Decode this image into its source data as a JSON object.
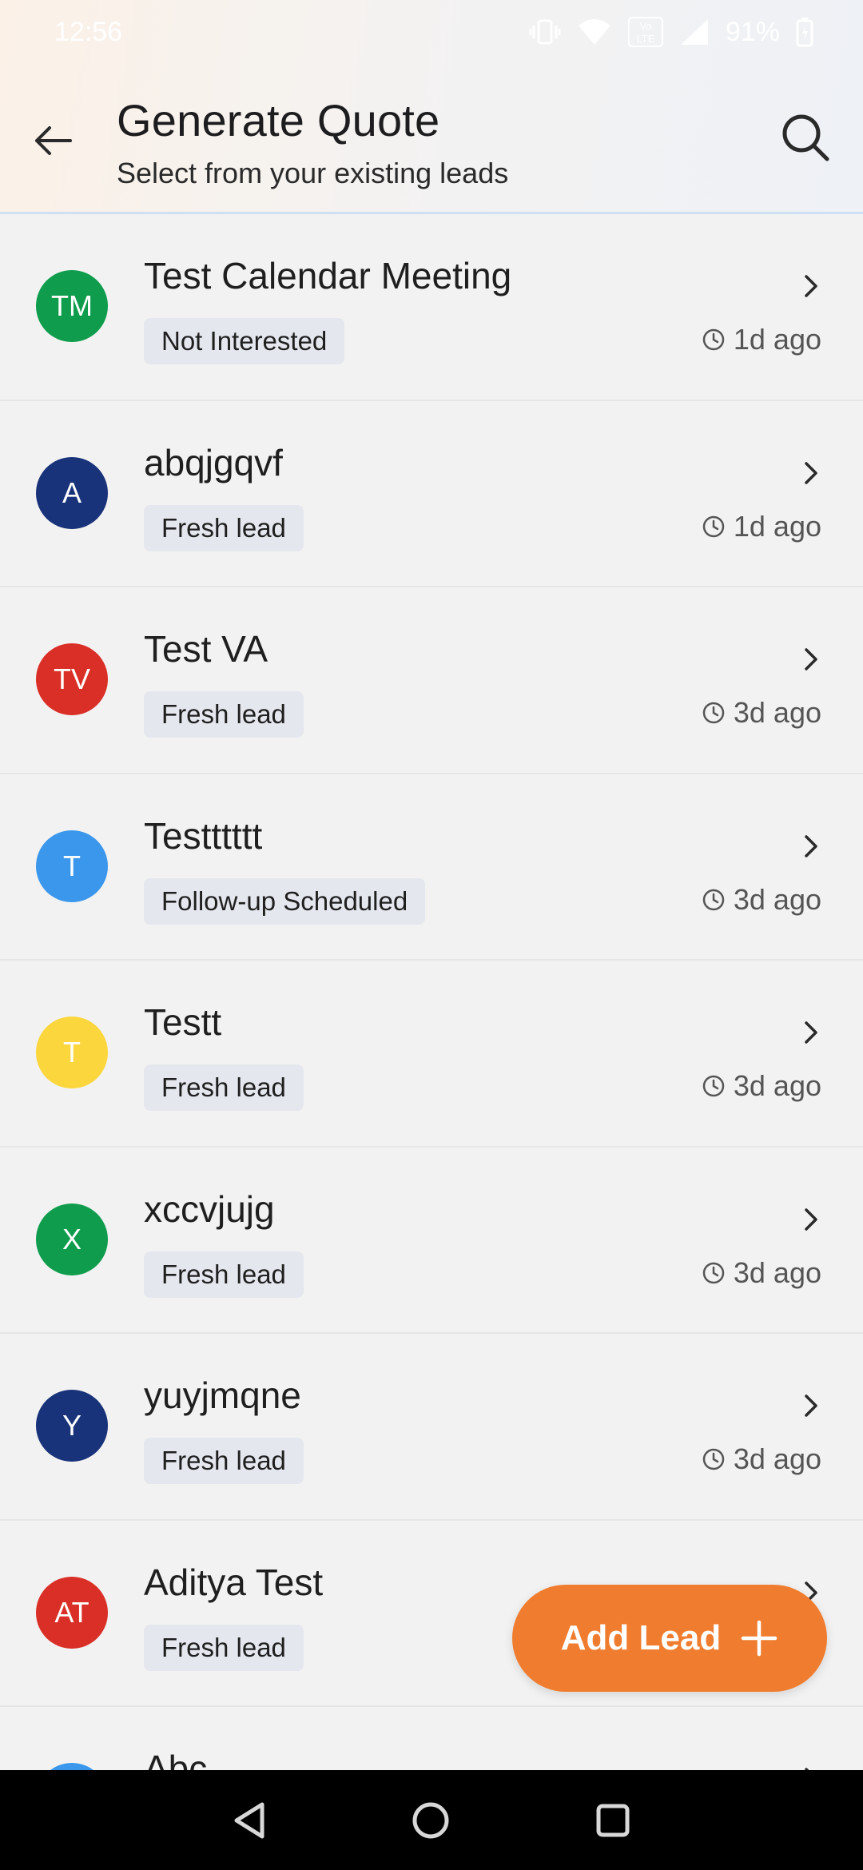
{
  "status_bar": {
    "time": "12:56",
    "battery": "91%",
    "icons": [
      "vibrate-icon",
      "wifi-icon",
      "volte-icon",
      "signal-icon",
      "battery-icon"
    ]
  },
  "header": {
    "title": "Generate Quote",
    "subtitle": "Select from your existing leads",
    "back_icon": "arrow-left-icon",
    "search_icon": "search-icon"
  },
  "leads": [
    {
      "initials": "TM",
      "name": "Test Calendar Meeting",
      "status": "Not Interested",
      "time": "1d ago",
      "color": "#0f9d4d"
    },
    {
      "initials": "A",
      "name": "abqjgqvf",
      "status": "Fresh lead",
      "time": "1d ago",
      "color": "#19337a"
    },
    {
      "initials": "TV",
      "name": "Test VA",
      "status": "Fresh lead",
      "time": "3d ago",
      "color": "#da2f27"
    },
    {
      "initials": "T",
      "name": "Testttttt",
      "status": "Follow-up Scheduled",
      "time": "3d ago",
      "color": "#3b97ec"
    },
    {
      "initials": "T",
      "name": "Testt",
      "status": "Fresh lead",
      "time": "3d ago",
      "color": "#fbd63c"
    },
    {
      "initials": "X",
      "name": "xccvjujg",
      "status": "Fresh lead",
      "time": "3d ago",
      "color": "#0f9d4d"
    },
    {
      "initials": "Y",
      "name": "yuyjmqne",
      "status": "Fresh lead",
      "time": "3d ago",
      "color": "#19337a"
    },
    {
      "initials": "AT",
      "name": "Aditya Test",
      "status": "Fresh lead",
      "time": "",
      "color": "#da2f27"
    },
    {
      "initials": "",
      "name": "Abc",
      "status": "",
      "time": "",
      "color": "#3b97ec"
    }
  ],
  "fab": {
    "label": "Add Lead",
    "icon": "plus-icon",
    "color": "#f07d2f"
  },
  "nav_bar": {
    "icons": [
      "back-triangle-icon",
      "home-circle-icon",
      "recents-square-icon"
    ]
  }
}
